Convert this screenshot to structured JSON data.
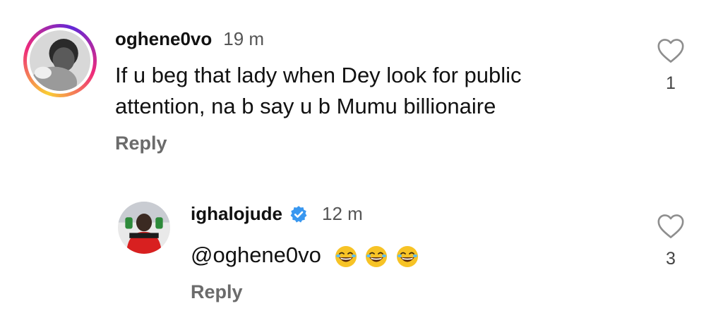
{
  "comments": [
    {
      "username": "oghene0vo",
      "time": "19 m",
      "text_lines": [
        "If u beg that lady when Dey look for public",
        "attention, na b say u b Mumu billionaire"
      ],
      "reply_label": "Reply",
      "likes": "1",
      "has_story_ring": true
    },
    {
      "username": "ighalojude",
      "verified": true,
      "time": "12 m",
      "mention": "@oghene0vo",
      "emojis": [
        "laughing-emoji",
        "laughing-emoji",
        "laughing-emoji"
      ],
      "reply_label": "Reply",
      "likes": "3",
      "has_story_ring": false
    }
  ],
  "colors": {
    "verified_blue": "#3897f0",
    "secondary_text": "#6b6b6b",
    "emoji_yellow": "#f7c325"
  }
}
